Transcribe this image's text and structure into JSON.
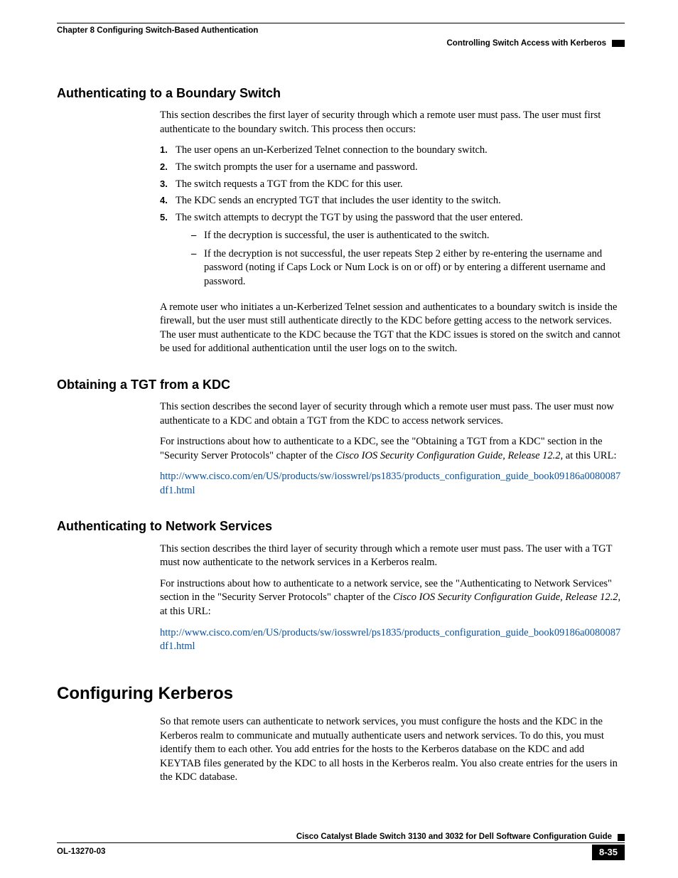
{
  "header": {
    "chapter": "Chapter 8      Configuring Switch-Based Authentication",
    "subhead": "Controlling Switch Access with Kerberos"
  },
  "sec1": {
    "title": "Authenticating to a Boundary Switch",
    "intro": "This section describes the first layer of security through which a remote user must pass. The user must first authenticate to the boundary switch. This process then occurs:",
    "steps": [
      "The user opens an un-Kerberized Telnet connection to the boundary switch.",
      "The switch prompts the user for a username and password.",
      "The switch requests a TGT from the KDC for this user.",
      "The KDC sends an encrypted TGT that includes the user identity to the switch.",
      "The switch attempts to decrypt the TGT by using the password that the user entered."
    ],
    "sub": [
      "If the decryption is successful, the user is authenticated to the switch.",
      "If the decryption is not successful, the user repeats Step 2 either by re-entering the username and password (noting if Caps Lock or Num Lock is on or off) or by entering a different username and password."
    ],
    "after": "A remote user who initiates a un-Kerberized Telnet session and authenticates to a boundary switch is inside the firewall, but the user must still authenticate directly to the KDC before getting access to the network services. The user must authenticate to the KDC because the TGT that the KDC issues is stored on the switch and cannot be used for additional authentication until the user logs on to the switch."
  },
  "sec2": {
    "title": "Obtaining a TGT from a KDC",
    "p1": "This section describes the second layer of security through which a remote user must pass. The user must now authenticate to a KDC and obtain a TGT from the KDC to access network services.",
    "p2a": "For instructions about how to authenticate to a KDC, see the \"Obtaining a TGT from a KDC\" section in the \"Security Server Protocols\" chapter of the ",
    "p2i": "Cisco IOS Security Configuration Guide, Release 12.2,",
    "p2b": " at this URL:",
    "link": "http://www.cisco.com/en/US/products/sw/iosswrel/ps1835/products_configuration_guide_book09186a0080087df1.html"
  },
  "sec3": {
    "title": "Authenticating to Network Services",
    "p1": "This section describes the third layer of security through which a remote user must pass. The user with a TGT must now authenticate to the network services in a Kerberos realm.",
    "p2a": "For instructions about how to authenticate to a network service, see the \"Authenticating to Network Services\" section in the \"Security Server Protocols\" chapter of the ",
    "p2i": "Cisco IOS Security Configuration Guide, Release 12.2,",
    "p2b": " at this URL:",
    "link": "http://www.cisco.com/en/US/products/sw/iosswrel/ps1835/products_configuration_guide_book09186a0080087df1.html"
  },
  "sec4": {
    "title": "Configuring Kerberos",
    "p1": "So that remote users can authenticate to network services, you must configure the hosts and the KDC in the Kerberos realm to communicate and mutually authenticate users and network services. To do this, you must identify them to each other. You add entries for the hosts to the Kerberos database on the KDC and add KEYTAB files generated by the KDC to all hosts in the Kerberos realm. You also create entries for the users in the KDC database."
  },
  "footer": {
    "guide": "Cisco Catalyst Blade Switch 3130 and 3032 for Dell Software Configuration Guide",
    "docnum": "OL-13270-03",
    "pagenum": "8-35"
  }
}
